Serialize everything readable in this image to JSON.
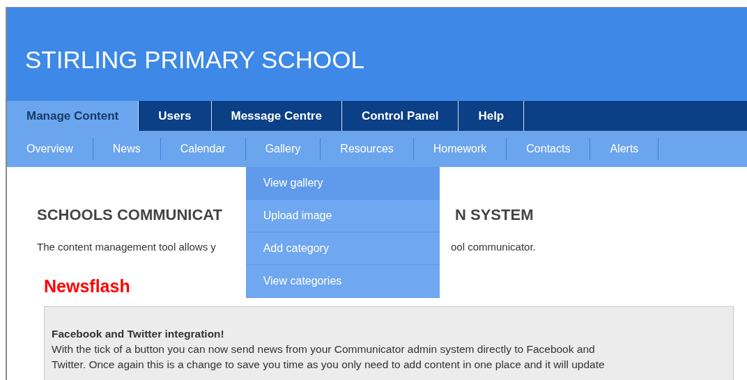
{
  "header": {
    "title": "STIRLING PRIMARY SCHOOL"
  },
  "tabs": [
    {
      "label": "Manage Content",
      "selected": true
    },
    {
      "label": "Users",
      "selected": false
    },
    {
      "label": "Message Centre",
      "selected": false
    },
    {
      "label": "Control Panel",
      "selected": false
    },
    {
      "label": "Help",
      "selected": false
    }
  ],
  "subnav": {
    "items": [
      {
        "label": "Overview"
      },
      {
        "label": "News"
      },
      {
        "label": "Calendar"
      },
      {
        "label": "Gallery",
        "dropdown": [
          {
            "label": "View gallery",
            "selected": true
          },
          {
            "label": "Upload image",
            "selected": false
          },
          {
            "label": "Add category",
            "selected": false
          },
          {
            "label": "View categories",
            "selected": false
          }
        ]
      },
      {
        "label": "Resources"
      },
      {
        "label": "Homework"
      },
      {
        "label": "Contacts"
      },
      {
        "label": "Alerts"
      }
    ]
  },
  "content": {
    "heading_visible_parts": [
      "SCHOOLS COMMUNICAT",
      "N SYSTEM"
    ],
    "intro_visible_parts": [
      "The content management tool allows y",
      "ool communicator."
    ],
    "newsflash": {
      "title": "Newsflash",
      "item_title": "Facebook and Twitter integration!",
      "body_lines": [
        "With the tick of a button you can now send news from your Communicator admin system directly to Facebook and",
        "Twitter. Once again this is a change to save you time as you only need to add content in one place and it will update"
      ]
    }
  }
}
